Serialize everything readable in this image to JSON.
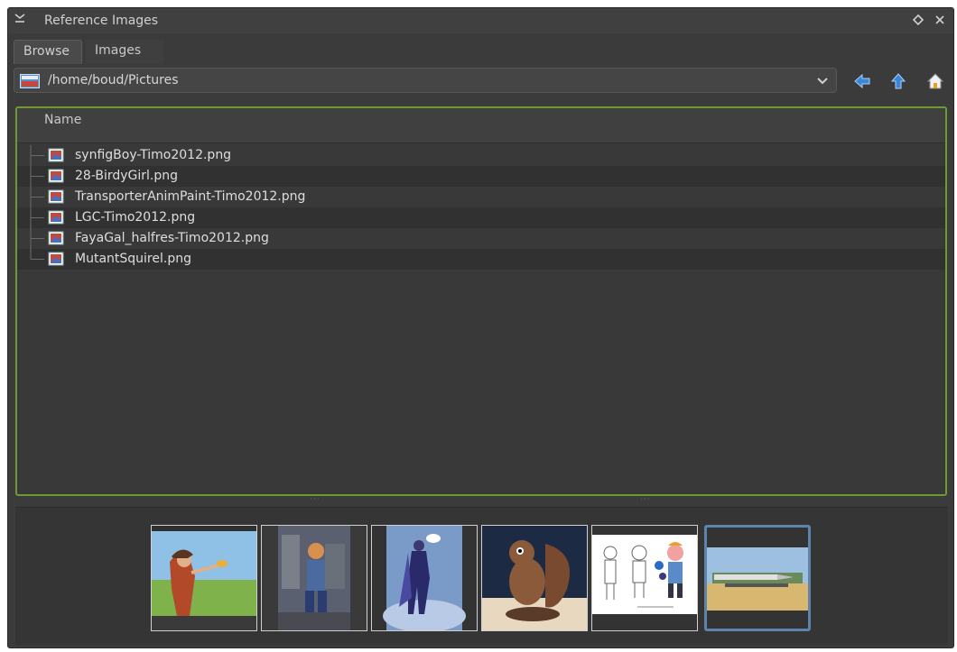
{
  "titlebar": {
    "title": "Reference Images",
    "menu_icon": "collapse-icon",
    "float_icon": "diamond-icon",
    "close_icon": "close-icon"
  },
  "tabs": [
    {
      "label": "Browse",
      "active": true
    },
    {
      "label": "Images",
      "active": false
    }
  ],
  "pathbar": {
    "path": "/home/boud/Pictures"
  },
  "nav": {
    "back_icon": "arrow-left-icon",
    "up_icon": "arrow-up-icon",
    "home_icon": "home-icon"
  },
  "filelist": {
    "header": "Name",
    "items": [
      {
        "name": "synfigBoy-Timo2012.png"
      },
      {
        "name": "28-BirdyGirl.png"
      },
      {
        "name": "TransporterAnimPaint-Timo2012.png"
      },
      {
        "name": "LGC-Timo2012.png"
      },
      {
        "name": "FayaGal_halfres-Timo2012.png"
      },
      {
        "name": "MutantSquirel.png"
      }
    ]
  },
  "thumbnails": [
    {
      "subject": "girl-with-bird",
      "selected": false
    },
    {
      "subject": "figure-in-city",
      "selected": false
    },
    {
      "subject": "flying-hero",
      "selected": false
    },
    {
      "subject": "squirrel-creature",
      "selected": false
    },
    {
      "subject": "character-sketches",
      "selected": false
    },
    {
      "subject": "rocket-transporter",
      "selected": true
    }
  ],
  "colors": {
    "accent_border": "#6f9a32",
    "selection": "#5e84ab",
    "nav_icon": "#3a86d8"
  }
}
